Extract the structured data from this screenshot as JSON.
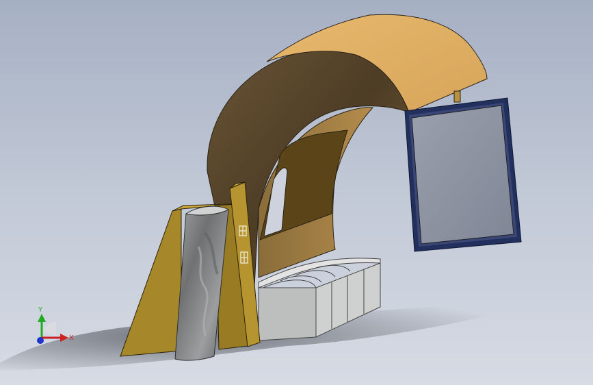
{
  "viewport": {
    "background_top": "#a6b0c3",
    "background_bottom": "#d6dbe4"
  },
  "triad": {
    "x_label": "X",
    "y_label": "Y",
    "x_color": "#cc2222",
    "y_color": "#22aa22",
    "z_color": "#2233cc",
    "icon": "coordinate-triad-icon"
  },
  "model": {
    "arch_color_top": "#e8b96e",
    "arch_color_side": "#5a4830",
    "panel_color": "#a7892c",
    "frame_color": "#1e2a55",
    "glass_color": "#8f96a6",
    "stone_color": "#8c8e8e",
    "bench_color": "#bfc0c0"
  }
}
